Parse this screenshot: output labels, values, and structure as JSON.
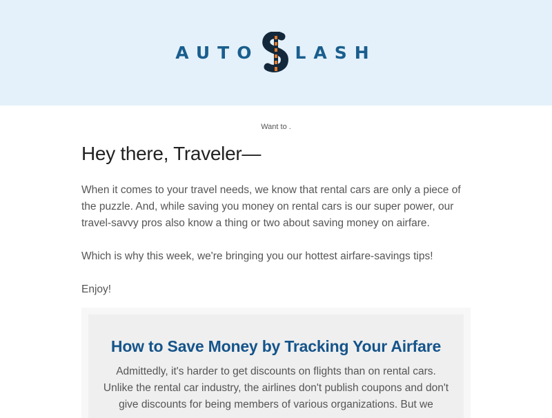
{
  "header": {
    "logo_left": "AUTO",
    "logo_right": "LASH",
    "logo_mark": "dollar-road-icon",
    "background_color": "#e4f1fa",
    "brand_color": "#1a5e8e",
    "accent_color": "#e07a2b"
  },
  "preheader": {
    "text": "Want to ."
  },
  "main": {
    "greeting": "Hey there, Traveler—",
    "paragraph_1": "When it comes to your travel needs, we know that rental cars are only a piece of the puzzle. And, while saving you money on rental cars is our super power, our travel-savvy pros also know a thing or two about saving money on airfare.",
    "paragraph_2": "Which is why this week, we're bringing you our hottest airfare-savings tips!",
    "paragraph_3": "Enjoy!"
  },
  "card": {
    "title": "How to Save Money by Tracking Your Airfare",
    "body": "Admittedly, it's harder to get discounts on flights than on rental cars. Unlike the rental car industry, the airlines don't publish coupons and don't give discounts for being members of various organizations. But we"
  }
}
